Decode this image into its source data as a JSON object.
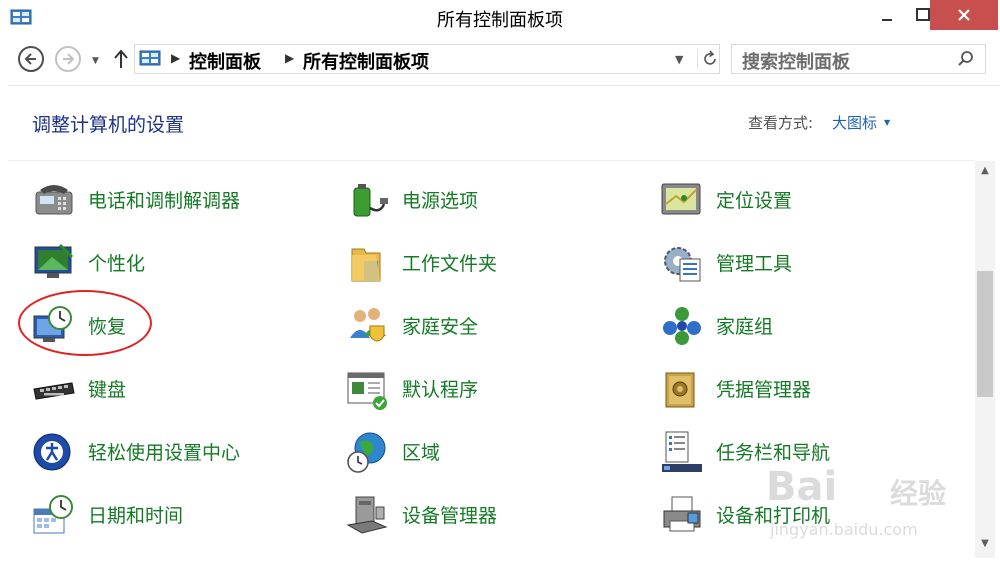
{
  "window": {
    "title": "所有控制面板项",
    "app_icon": "control-panel-icon"
  },
  "address": {
    "crumbs": [
      "控制面板",
      "所有控制面板项"
    ]
  },
  "search": {
    "placeholder": "搜索控制面板"
  },
  "header": {
    "heading": "调整计算机的设置",
    "view_by_label": "查看方式:",
    "view_by_value": "大图标"
  },
  "items": [
    {
      "label": "电话和调制解调器",
      "icon": "phone-modem-icon"
    },
    {
      "label": "电源选项",
      "icon": "battery-icon"
    },
    {
      "label": "定位设置",
      "icon": "location-icon"
    },
    {
      "label": "个性化",
      "icon": "personalization-icon"
    },
    {
      "label": "工作文件夹",
      "icon": "folder-icon"
    },
    {
      "label": "管理工具",
      "icon": "admin-tools-icon"
    },
    {
      "label": "恢复",
      "icon": "recovery-icon"
    },
    {
      "label": "家庭安全",
      "icon": "family-safety-icon"
    },
    {
      "label": "家庭组",
      "icon": "homegroup-icon"
    },
    {
      "label": "键盘",
      "icon": "keyboard-icon"
    },
    {
      "label": "默认程序",
      "icon": "default-programs-icon"
    },
    {
      "label": "凭据管理器",
      "icon": "credential-manager-icon"
    },
    {
      "label": "轻松使用设置中心",
      "icon": "ease-of-access-icon"
    },
    {
      "label": "区域",
      "icon": "globe-clock-icon"
    },
    {
      "label": "任务栏和导航",
      "icon": "taskbar-icon"
    },
    {
      "label": "日期和时间",
      "icon": "calendar-clock-icon"
    },
    {
      "label": "设备管理器",
      "icon": "device-manager-icon"
    },
    {
      "label": "设备和打印机",
      "icon": "printer-icon"
    }
  ],
  "watermark": {
    "brand": "Bai",
    "brand2": "经验",
    "url": "jingyan.baidu.com"
  },
  "colors": {
    "title_text": "#000000",
    "close_button": "#c7504f",
    "heading": "#1e3287",
    "item_label": "#147a25",
    "view_by_value": "#1e62b6",
    "highlight": "#e02323"
  }
}
